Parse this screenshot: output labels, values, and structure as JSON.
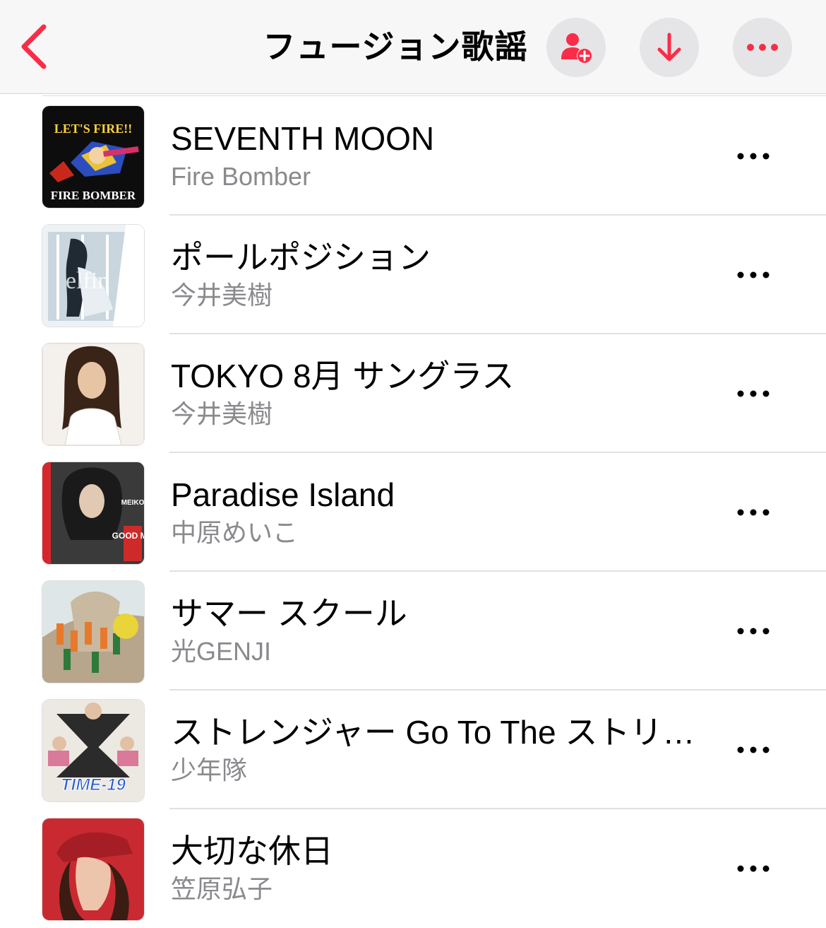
{
  "header": {
    "title": "フュージョン歌謡",
    "accent_color": "#fa2d48",
    "back_icon": "chevron-left-icon",
    "buttons": [
      {
        "name": "add-collaborator-button",
        "icon": "person-plus-icon"
      },
      {
        "name": "download-button",
        "icon": "arrow-down-icon"
      },
      {
        "name": "more-button",
        "icon": "ellipsis-icon"
      }
    ]
  },
  "songs": [
    {
      "title": "SEVENTH MOON",
      "artist": "Fire Bomber",
      "art_text": "LET'S FIRE!!",
      "art_text2": "FIRE BOMBER"
    },
    {
      "title": "ポールポジション",
      "artist": "今井美樹",
      "art_text": "elfin"
    },
    {
      "title": "TOKYO 8月 サングラス",
      "artist": "今井美樹"
    },
    {
      "title": "Paradise Island",
      "artist": "中原めいこ",
      "art_text": "GOOD MN",
      "art_text2": "MEIKO"
    },
    {
      "title": "サマー スクール",
      "artist": "光GENJI"
    },
    {
      "title": "ストレンジャー Go To The ストリート",
      "artist": "少年隊",
      "art_text": "TIME-19"
    },
    {
      "title": "大切な休日",
      "artist": "笠原弘子"
    }
  ]
}
